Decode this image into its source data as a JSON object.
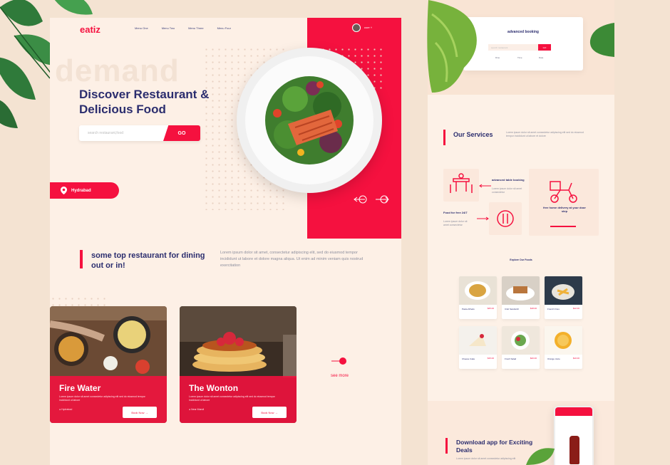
{
  "brand": {
    "logo": "eatiz",
    "accent": "#f5113f",
    "navy": "#2b2d6e"
  },
  "nav": {
    "items": [
      "Menu One",
      "Menu Two",
      "Menu Three",
      "Menu Four"
    ],
    "user": "user"
  },
  "hero": {
    "watermark": "demand",
    "title": "Discover Restaurant & Delicious Food",
    "search_placeholder": "search restaurant,food",
    "go_label": "GO",
    "location": "Hydrabad"
  },
  "section": {
    "title": "some top restaurant for dining out or in!",
    "text": "Lorem ipsum dolor sit amet, consectetur adipiscing elit, sed do eiusmod tempor incididunt ut labore et dolore magna aliqua. Ut enim ad minim veniam quis nostrud exercitation"
  },
  "cards": [
    {
      "title": "Fire Water",
      "desc": "Lorem ipsum dolor sit amet consectetur adipiscing elit sed do eiusmod tempor incididunt ut labore",
      "location": "Hydrabad",
      "button": "Book Now"
    },
    {
      "title": "The Wonton",
      "desc": "Lorem ipsum dolor sit amet consectetur adipiscing elit sed do eiusmod tempor incididunt ut labore",
      "location": "Near Mandi",
      "button": "Book Now"
    }
  ],
  "see_more": "see more",
  "page2": {
    "booking": {
      "title": "advanced booking",
      "placeholder": "search restaurant",
      "button": "GO",
      "labels": [
        "Dine",
        "Time",
        "Date"
      ]
    },
    "services": {
      "title": "Our Services",
      "intro": "Lorem ipsum dolor sit amet consectetur adipiscing elit sed do eiusmod tempor incididunt ut labore et dolore",
      "items": [
        {
          "label": "advanced table booking",
          "text": "Lorem ipsum dolor sit amet consectetur"
        },
        {
          "label": "Food for free 24/7",
          "text": "Lorem ipsum dolor sit amet consectetur"
        },
        {
          "label": "free home delivery at your door step",
          "text": ""
        }
      ]
    },
    "explore": {
      "title": "Explore Our Foods",
      "foods": [
        {
          "name": "Pasta Alfredo",
          "price": "$25.00"
        },
        {
          "name": "Club Sandwich",
          "price": "$18.00"
        },
        {
          "name": "French Fries",
          "price": "$12.00"
        },
        {
          "name": "Cheese Cake",
          "price": "$15.00"
        },
        {
          "name": "Fresh Salad",
          "price": "$20.00"
        },
        {
          "name": "Orange Juice",
          "price": "$10.00"
        }
      ]
    },
    "download": {
      "title": "Download app for Exciting Deals",
      "text": "Lorem ipsum dolor sit amet consectetur adipiscing elit"
    }
  }
}
